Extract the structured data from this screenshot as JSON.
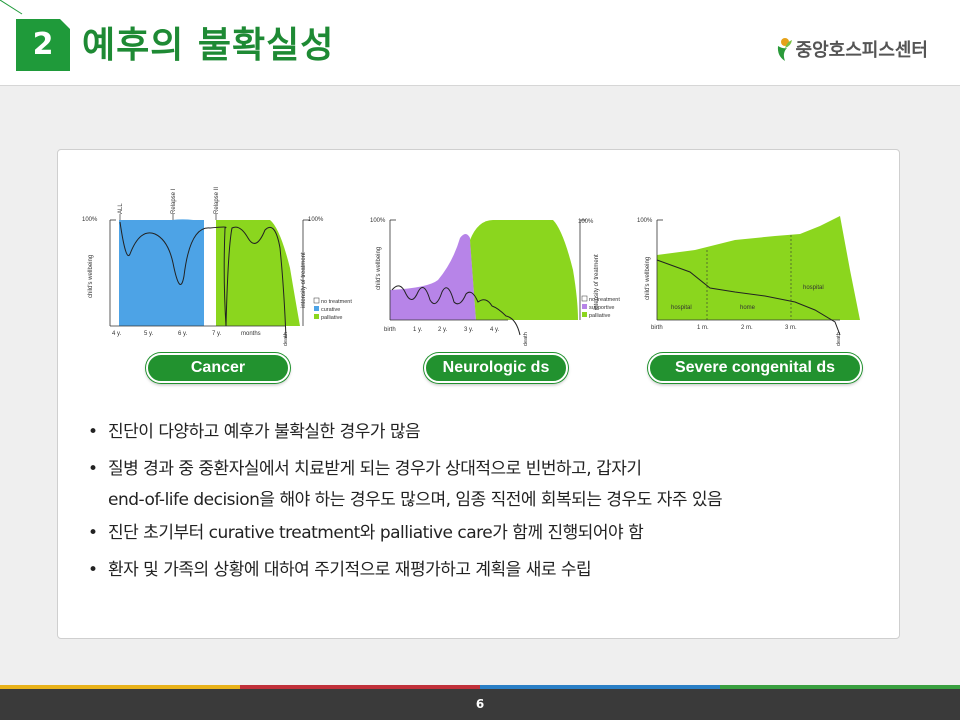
{
  "header": {
    "section_number": "2",
    "title": "예후의 불확실성",
    "logo_text": "중앙호스피스센터"
  },
  "colors": {
    "brand_green": "#1f9a3a",
    "curative_blue": "#4da3e6",
    "palliative_green": "#8bd61e",
    "supportive_purple": "#b784e8"
  },
  "panels": {
    "cancer": {
      "label": "Cancer",
      "y_left": "100%",
      "y_right": "100%",
      "y_axis_left": "child's wellbeing",
      "y_axis_right": "intensity of treatment",
      "events": [
        "ALL",
        "Relapse I",
        "Relapse II"
      ],
      "ticks": [
        "4 y.",
        "5 y.",
        "6 y.",
        "7 y.",
        "months"
      ],
      "end_label": "death",
      "legend": [
        "no treatment",
        "curative",
        "palliative"
      ]
    },
    "neuro": {
      "label": "Neurologic ds",
      "y_left": "100%",
      "y_right": "100%",
      "y_axis_left": "child's wellbeing",
      "y_axis_right": "intensity of treatment",
      "ticks": [
        "birth",
        "1 y.",
        "2 y.",
        "3 y.",
        "4 y."
      ],
      "end_label": "death",
      "legend": [
        "no treatment",
        "supportive",
        "palliative"
      ]
    },
    "congenital": {
      "label": "Severe congenital ds",
      "y_left": "100%",
      "y_axis_left": "child's wellbeing",
      "ticks": [
        "birth",
        "1 m.",
        "2 m.",
        "3 m."
      ],
      "end_label": "death",
      "regions": [
        "hospital",
        "home",
        "hospital"
      ]
    }
  },
  "bullets": [
    "진단이 다양하고 예후가 불확실한 경우가 많음",
    "질병 경과 중 중환자실에서 치료받게 되는 경우가 상대적으로 빈번하고, 갑자기",
    "end-of-life decision을 해야 하는 경우도 많으며, 임종 직전에 회복되는 경우도 자주 있음",
    "진단 초기부터 curative treatment와 palliative care가 함께 진행되어야 함",
    "환자 및 가족의 상황에 대하여 주기적으로 재평가하고 계획을 새로 수립"
  ],
  "footer": {
    "page_number": "6"
  }
}
